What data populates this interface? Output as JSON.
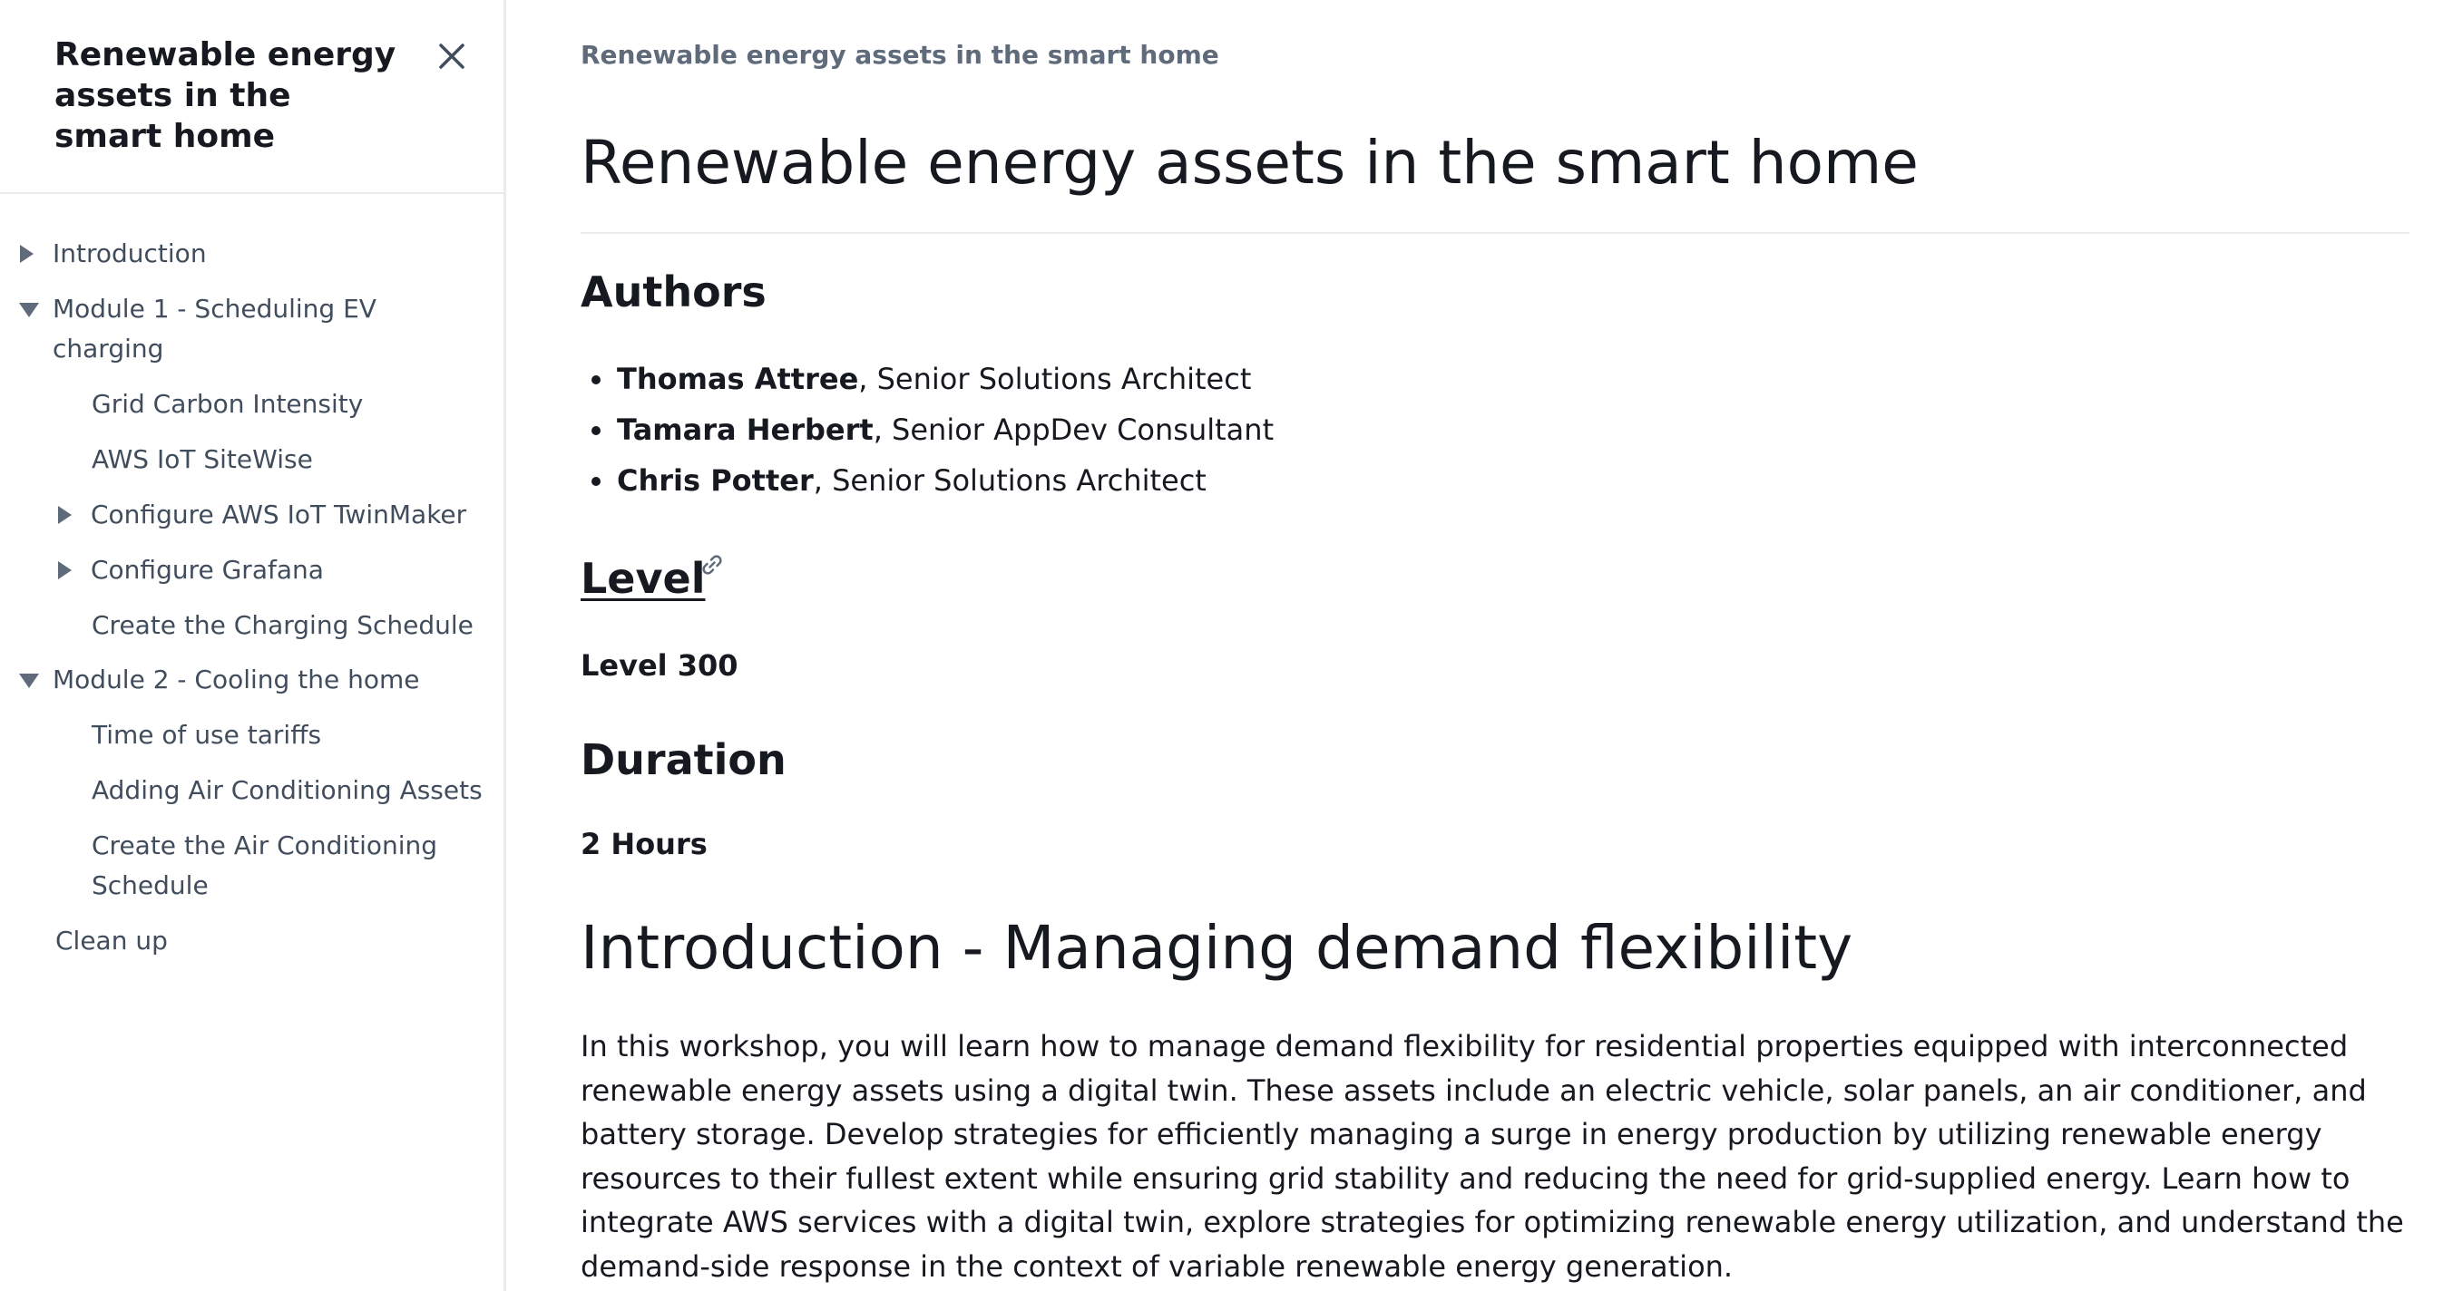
{
  "sidebar": {
    "title": "Renewable energy assets in the smart home",
    "close_icon": "close-icon",
    "items": [
      {
        "label": "Introduction",
        "expander": "caret-right-icon"
      },
      {
        "label": "Module 1 - Scheduling EV charging",
        "expander": "caret-down-icon"
      },
      {
        "label": "Grid Carbon Intensity"
      },
      {
        "label": "AWS IoT SiteWise"
      },
      {
        "label": "Configure AWS IoT TwinMaker",
        "expander": "caret-right-icon"
      },
      {
        "label": "Configure Grafana",
        "expander": "caret-right-icon"
      },
      {
        "label": "Create the Charging Schedule"
      },
      {
        "label": "Module 2 - Cooling the home",
        "expander": "caret-down-icon"
      },
      {
        "label": "Time of use tariffs"
      },
      {
        "label": "Adding Air Conditioning Assets"
      },
      {
        "label": "Create the Air Conditioning Schedule"
      },
      {
        "label": "Clean up"
      }
    ]
  },
  "main": {
    "breadcrumb": "Renewable energy assets in the smart home",
    "title": "Renewable energy assets in the smart home",
    "authors_heading": "Authors",
    "authors": [
      {
        "name": "Thomas Attree",
        "role": ", Senior Solutions Architect"
      },
      {
        "name": "Tamara Herbert",
        "role": ", Senior AppDev Consultant"
      },
      {
        "name": "Chris Potter",
        "role": ", Senior Solutions Architect"
      }
    ],
    "level_heading": "Level",
    "level_link_icon": "link-icon",
    "level_value": "Level 300",
    "duration_heading": "Duration",
    "duration_value": "2 Hours",
    "intro_heading": "Introduction - Managing demand flexibility",
    "intro_body": "In this workshop, you will learn how to manage demand flexibility for residential properties equipped with interconnected renewable energy assets using a digital twin. These assets include an electric vehicle, solar panels, an air conditioner, and battery storage. Develop strategies for efficiently managing a surge in energy production by utilizing renewable energy resources to their fullest extent while ensuring grid stability and reducing the need for grid-supplied energy. Learn how to integrate AWS services with a digital twin, explore strategies for optimizing renewable energy utilization, and understand the demand-side response in the context of variable renewable energy generation."
  }
}
